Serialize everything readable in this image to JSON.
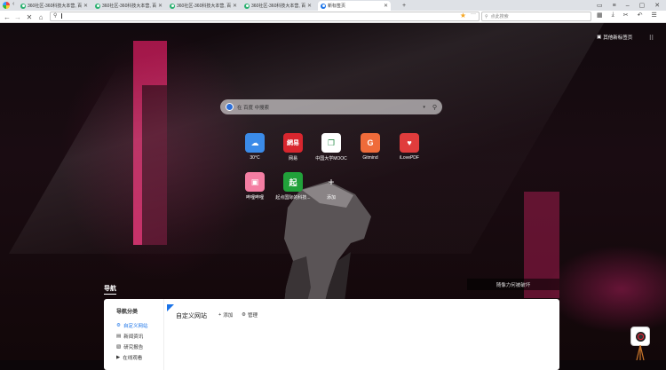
{
  "tabs": [
    {
      "title": "360社区-360科技大本营, 百",
      "active": false
    },
    {
      "title": "360社区-360科技大本营, 百",
      "active": false
    },
    {
      "title": "360社区-360科技大本营, 百",
      "active": false
    },
    {
      "title": "360社区-360科技大本营, 百",
      "active": false
    },
    {
      "title": "新标签页",
      "active": true
    }
  ],
  "toolbar": {
    "address_value": "",
    "search_placeholder": "点此搜索"
  },
  "newtab": {
    "top_button": "其他新标签页",
    "search_placeholder": "在 百度 中搜索",
    "tiles": [
      {
        "label": "30°C",
        "icon": "weather-icon",
        "color": "#3b8be8",
        "glyph": "☁"
      },
      {
        "label": "网易",
        "icon": "netease-icon",
        "color": "#d8262e",
        "glyph": "網易"
      },
      {
        "label": "中国大学MOOC",
        "icon": "mooc-icon",
        "color": "#ffffff",
        "glyph": "❐"
      },
      {
        "label": "Gitmind",
        "icon": "gitmind-icon",
        "color": "#ef6b3a",
        "glyph": "G"
      },
      {
        "label": "iLovePDF",
        "icon": "ilovepdf-icon",
        "color": "#e03c3c",
        "glyph": "♥"
      },
      {
        "label": "哔哩哔哩",
        "icon": "bilibili-icon",
        "color": "#f47ea3",
        "glyph": "▣"
      },
      {
        "label": "起点国际的科技...",
        "icon": "qidian-icon",
        "color": "#21a13a",
        "glyph": "起"
      },
      {
        "label": "添加",
        "icon": "add-icon",
        "color": "transparent",
        "glyph": "+"
      }
    ],
    "quote": "随像力何被破坏",
    "nav_title": "导航"
  },
  "panel": {
    "sidebar_title": "导航分类",
    "sidebar_items": [
      "自定义网站",
      "新闻资讯",
      "研究报告",
      "在线观看"
    ],
    "title": "自定义网站",
    "add_label": "添加",
    "manage_label": "管理"
  }
}
